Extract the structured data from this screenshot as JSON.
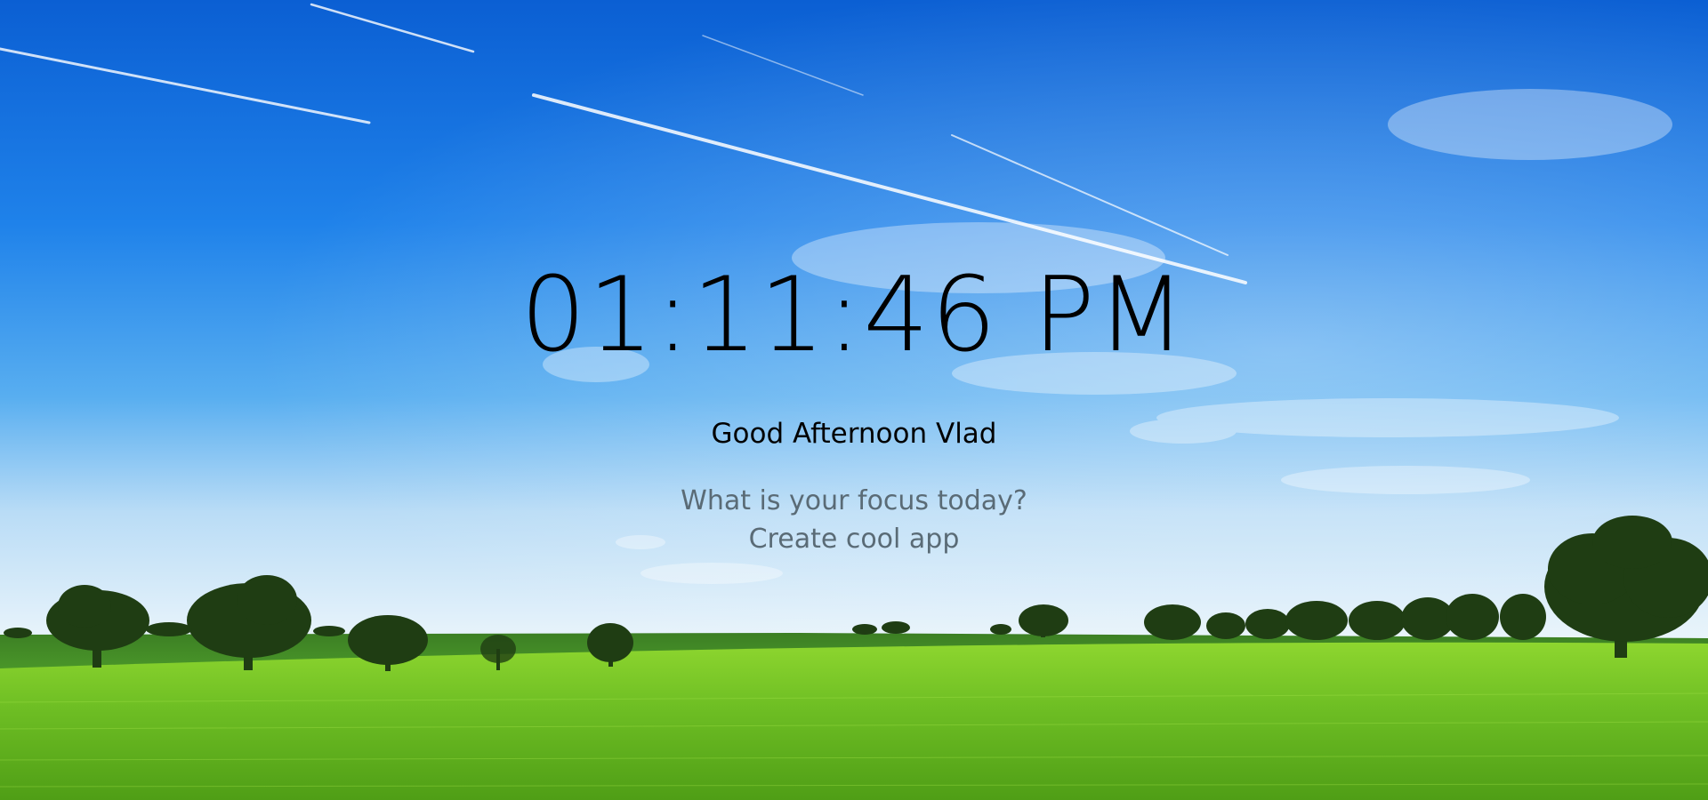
{
  "clock": {
    "time": "01:11:46 PM"
  },
  "greeting": {
    "text": "Good Afternoon Vlad"
  },
  "focus": {
    "question": "What is your focus today?",
    "value": "Create cool app"
  },
  "colors": {
    "sky_top": "#0a62d6",
    "sky_mid": "#2a8ef0",
    "sky_horizon": "#dcecf8",
    "grass_far": "#3f8a24",
    "grass_near": "#7cc72a",
    "clock_text": "#000000",
    "focus_text": "#5a6b76"
  }
}
